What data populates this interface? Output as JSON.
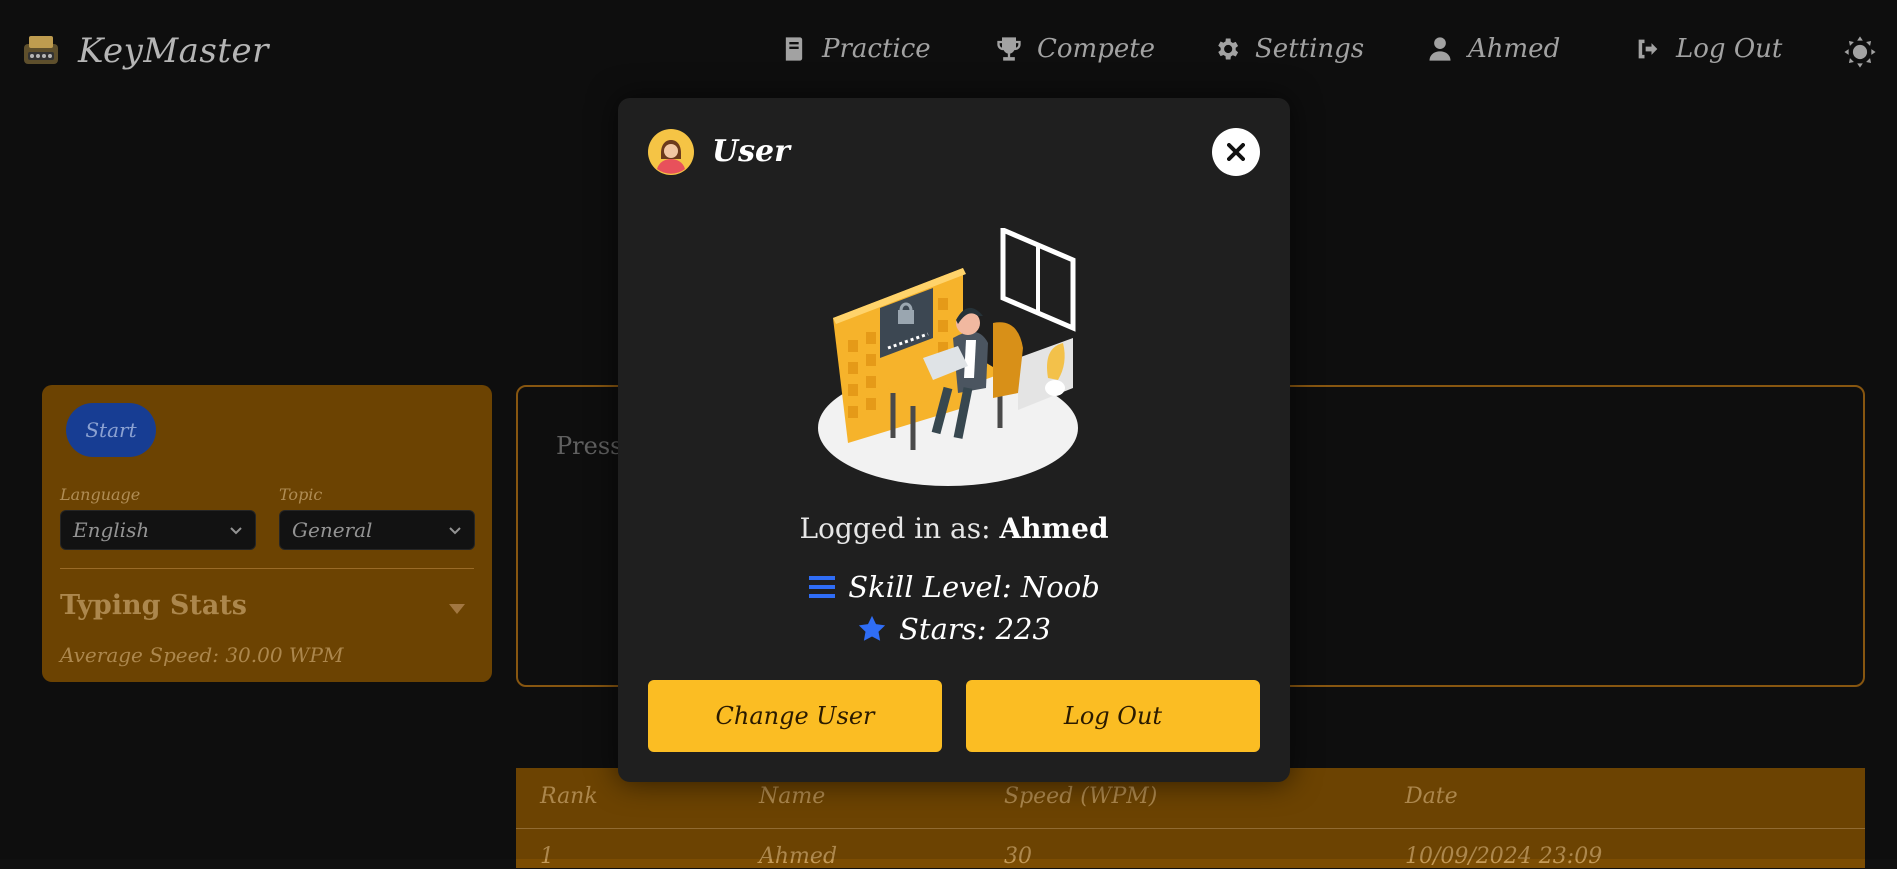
{
  "app": {
    "brand": "KeyMaster"
  },
  "nav": {
    "practice": "Practice",
    "compete": "Compete",
    "settings": "Settings",
    "user": "Ahmed",
    "logout": "Log Out"
  },
  "panel": {
    "start": "Start",
    "language_label": "Language",
    "language_value": "English",
    "topic_label": "Topic",
    "topic_value": "General",
    "stats_title": "Typing Stats",
    "average_speed": "Average Speed: 30.00 WPM"
  },
  "typing": {
    "placeholder": "Press"
  },
  "table": {
    "headers": [
      "Rank",
      "Name",
      "Speed (WPM)",
      "Date"
    ],
    "rows": [
      [
        "1",
        "Ahmed",
        "30",
        "10/09/2024 23:09"
      ]
    ]
  },
  "modal": {
    "title": "User",
    "logged_prefix": "Logged in as:",
    "username": "Ahmed",
    "skill_label": "Skill Level: Noob",
    "stars_label": "Stars: 223",
    "change_user": "Change User",
    "logout": "Log Out"
  },
  "colors": {
    "accent": "#fbbd23",
    "panel": "#7c4d03",
    "primary_blue": "#1b46a8",
    "icon_blue": "#2f6df6",
    "background": "#101010",
    "modal": "#1f1f1f"
  },
  "icons": [
    "typewriter-logo-icon",
    "book-icon",
    "trophy-icon",
    "gear-icon",
    "user-icon",
    "sign-out-icon",
    "sun-icon",
    "chevron-down-icon",
    "caret-down-icon",
    "avatar-icon",
    "close-icon",
    "bars-icon",
    "star-icon"
  ]
}
